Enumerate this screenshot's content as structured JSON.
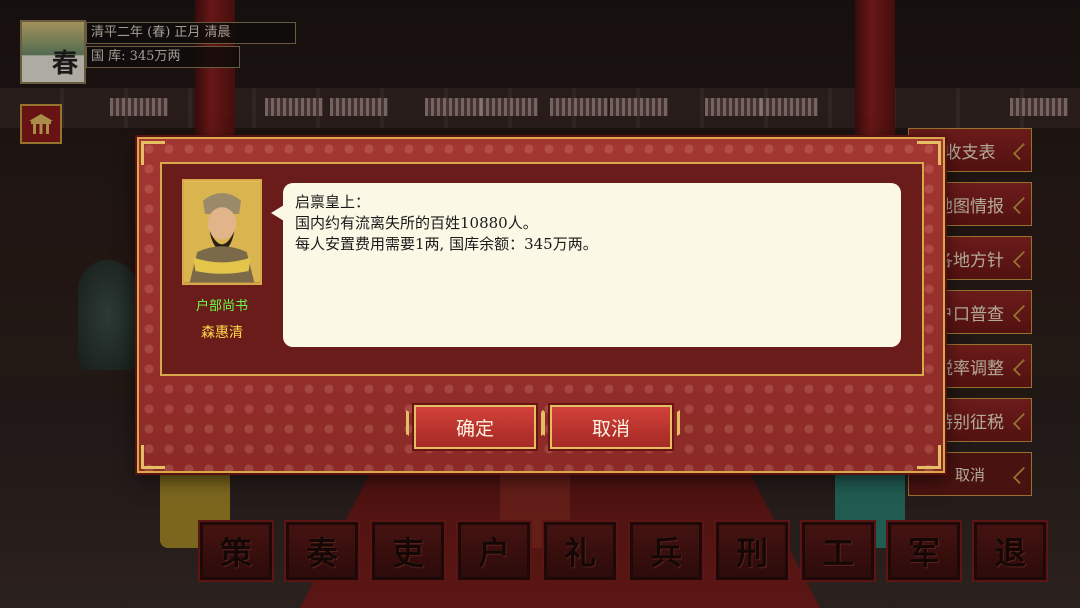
{
  "status": {
    "season_char": "春",
    "date_text": "清平二年 (春) 正月 清晨",
    "treasury_text": "国 库: 345万两"
  },
  "side_menu": {
    "items": [
      {
        "label": "收支表"
      },
      {
        "label": "地图情报"
      },
      {
        "label": "各地方针"
      },
      {
        "label": "户口普查"
      },
      {
        "label": "税率调整"
      },
      {
        "label": "特别征税"
      },
      {
        "label": "取消"
      }
    ]
  },
  "bottom_bar": {
    "buttons": [
      {
        "label": "策"
      },
      {
        "label": "奏"
      },
      {
        "label": "吏"
      },
      {
        "label": "户"
      },
      {
        "label": "礼"
      },
      {
        "label": "兵"
      },
      {
        "label": "刑"
      },
      {
        "label": "工"
      },
      {
        "label": "军"
      },
      {
        "label": "退"
      }
    ]
  },
  "dialog": {
    "minister_title": "户部尚书",
    "minister_name": "森惠清",
    "message_lines": [
      "启禀皇上：",
      "国内约有流离失所的百姓10880人。",
      "每人安置费用需要1两, 国库余额：345万两。"
    ],
    "confirm_label": "确定",
    "cancel_label": "取消"
  },
  "colors": {
    "dialog_red": "#8b2a27",
    "gold_border": "#d9a84a",
    "title_green": "#6cff4a",
    "name_yellow": "#ffd84a",
    "speech_bg": "#fbf8e6"
  },
  "icons": {
    "palace_button": "palace-icon"
  }
}
